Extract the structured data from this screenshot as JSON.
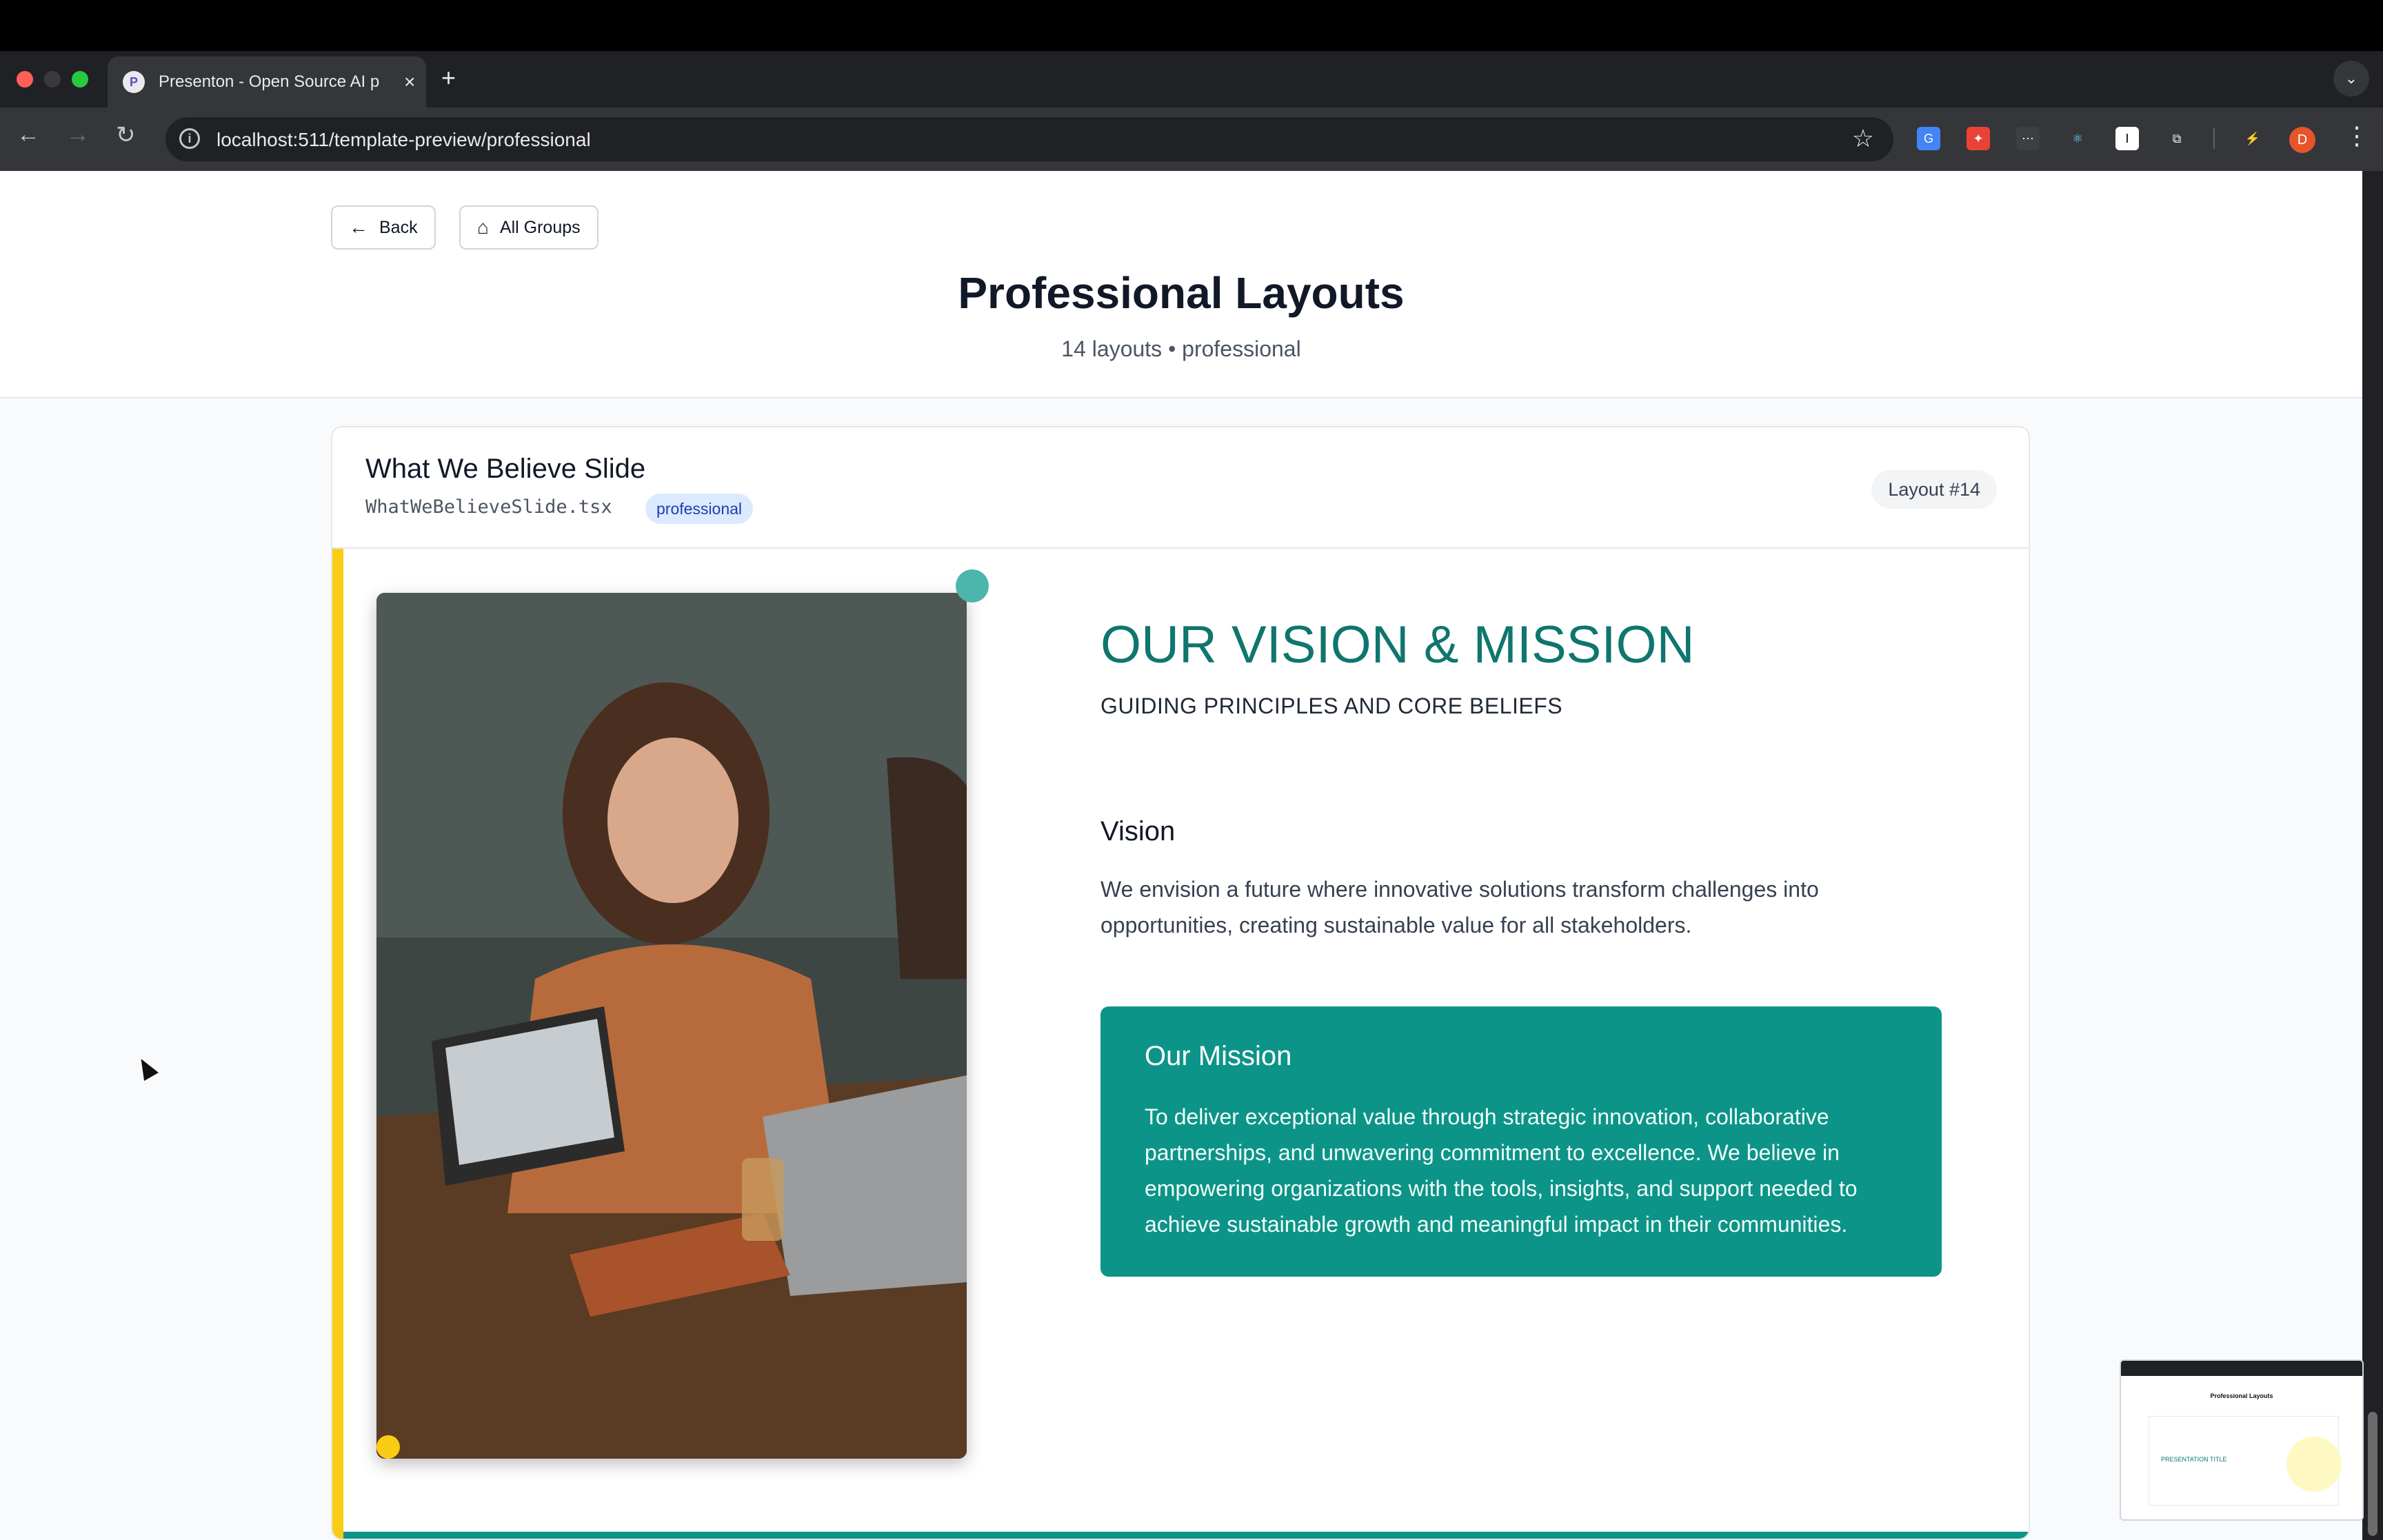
{
  "browser": {
    "tab_title": "Presenton - Open Source AI p",
    "favicon": "P",
    "tab_close": "×",
    "new_tab": "+",
    "url": "localhost:511/template-preview/professional",
    "profile_initial": "D"
  },
  "header": {
    "back_label": "Back",
    "all_groups_label": "All Groups",
    "title": "Professional Layouts",
    "subtitle": "14 layouts • professional"
  },
  "card": {
    "title": "What We Believe Slide",
    "file": "WhatWeBelieveSlide.tsx",
    "tag": "professional",
    "layout_number": "Layout #14"
  },
  "slide": {
    "title": "OUR VISION & MISSION",
    "subtitle": "GUIDING PRINCIPLES AND CORE BELIEFS",
    "vision_heading": "Vision",
    "vision_text": "We envision a future where innovative solutions transform challenges into opportunities, creating sustainable value for all stakeholders.",
    "mission_heading": "Our Mission",
    "mission_text": "To deliver exceptional value through strategic innovation, collaborative partnerships, and unwavering commitment to excellence. We believe in empowering organizations with the tools, insights, and support needed to achieve sustainable growth and meaningful impact in their communities."
  },
  "thumbnail": {
    "title": "Professional Layouts",
    "slide_title": "PRESENTATION TITLE"
  },
  "colors": {
    "accent_teal": "#0d9488",
    "title_teal": "#0f766e",
    "accent_yellow": "#facc15"
  }
}
